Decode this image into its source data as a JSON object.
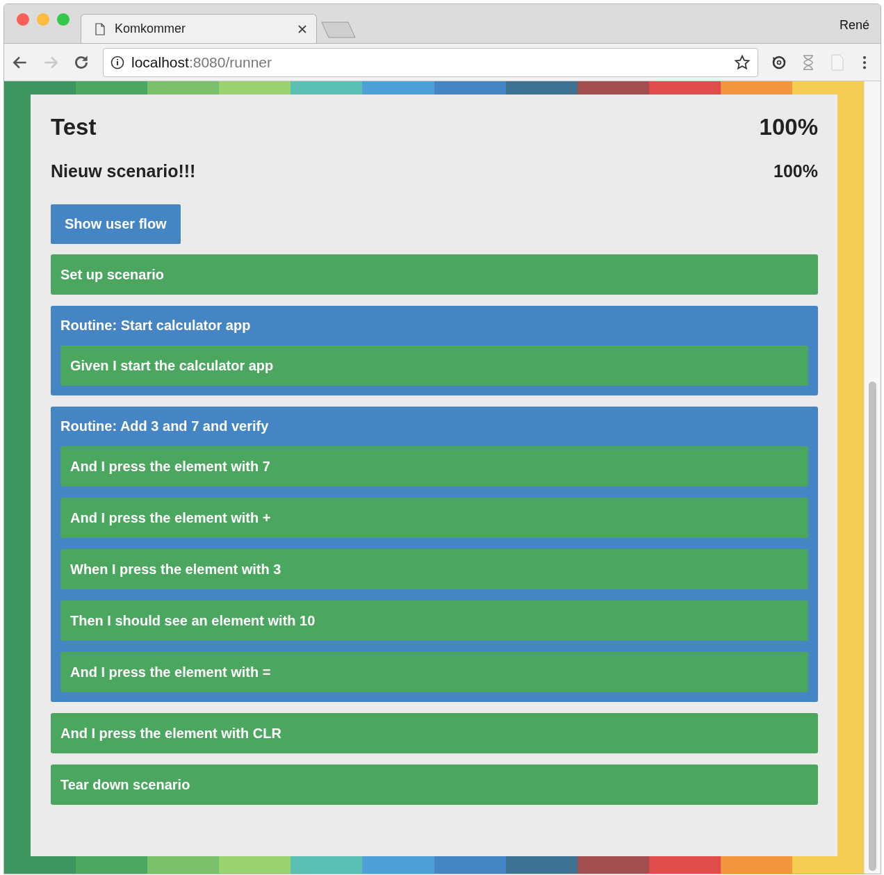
{
  "browser": {
    "tab_title": "Komkommer",
    "user": "René",
    "url_host": "localhost",
    "url_rest": ":8080/runner",
    "nav": [
      {
        "kind": "back",
        "disabled": false
      },
      {
        "kind": "forward",
        "disabled": true
      },
      {
        "kind": "reload",
        "disabled": false
      }
    ]
  },
  "page": {
    "title": "Test",
    "title_percent": "100%",
    "scenario": "Nieuw scenario!!!",
    "scenario_percent": "100%",
    "button": "Show user flow",
    "steps": [
      {
        "kind": "step",
        "passed": true,
        "text": "Set up scenario"
      },
      {
        "kind": "routine",
        "text": "Routine: Start calculator app",
        "children": [
          {
            "kind": "step",
            "passed": true,
            "text": "Given I start the calculator app"
          }
        ]
      },
      {
        "kind": "routine",
        "text": "Routine: Add 3 and 7 and verify",
        "children": [
          {
            "kind": "step",
            "passed": true,
            "text": "And I press the element with 7"
          },
          {
            "kind": "step",
            "passed": true,
            "text": "And I press the element with +"
          },
          {
            "kind": "step",
            "passed": true,
            "text": "When I press the element with 3"
          },
          {
            "kind": "step",
            "passed": true,
            "text": "Then I should see an element with 10"
          },
          {
            "kind": "step",
            "passed": true,
            "text": "And I press the element with ="
          }
        ]
      },
      {
        "kind": "step",
        "passed": true,
        "text": "And I press the element with CLR"
      },
      {
        "kind": "step",
        "passed": true,
        "text": "Tear down scenario"
      }
    ]
  }
}
